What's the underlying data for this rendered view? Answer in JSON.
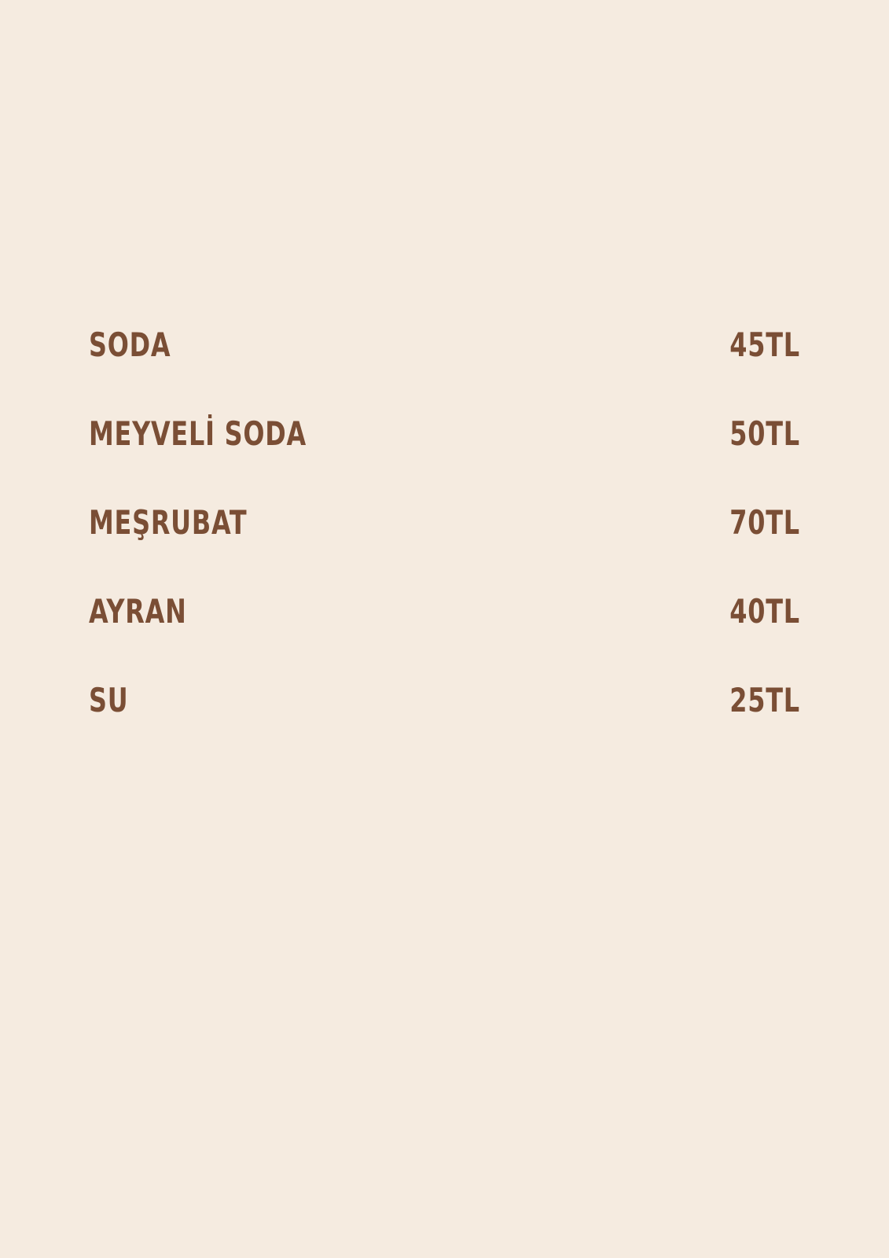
{
  "menu": {
    "items": [
      {
        "name": "SODA",
        "price": "45TL"
      },
      {
        "name": "MEYVELİ SODA",
        "price": "50TL"
      },
      {
        "name": "MEŞRUBAT",
        "price": "70TL"
      },
      {
        "name": "AYRAN",
        "price": "40TL"
      },
      {
        "name": "SU",
        "price": "25TL"
      }
    ]
  },
  "colors": {
    "background": "#f5ebe0",
    "text": "#7a4e35"
  }
}
